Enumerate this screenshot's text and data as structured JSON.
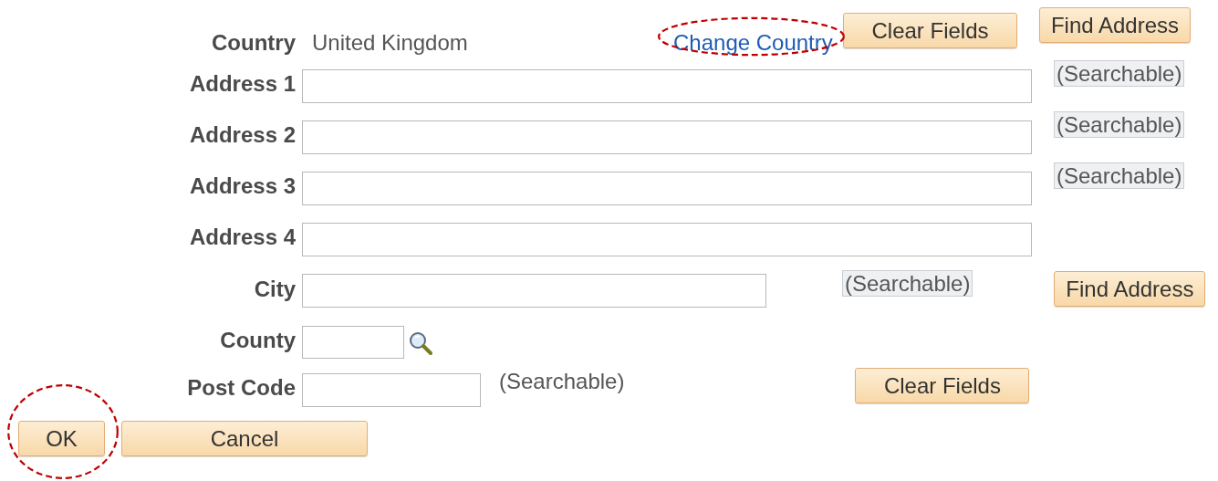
{
  "country": {
    "label": "Country",
    "value": "United Kingdom"
  },
  "change_country": {
    "label": "Change Country",
    "highlighted": true
  },
  "top_buttons": [
    {
      "label": "Clear Fields"
    },
    {
      "label": "Find Address"
    }
  ],
  "rows": [
    {
      "kind": "address",
      "label": "Address 1",
      "note": {
        "text": "(Searchable)",
        "boxed": true
      }
    },
    {
      "kind": "address",
      "label": "Address 2",
      "note": {
        "text": "(Searchable)",
        "boxed": true
      }
    },
    {
      "kind": "address",
      "label": "Address 3",
      "note": {
        "text": "(Searchable)",
        "boxed": true
      }
    },
    {
      "kind": "address",
      "label": "Address 4"
    },
    {
      "kind": "city",
      "label": "City",
      "note": {
        "text": "(Searchable)",
        "boxed": true
      },
      "button": {
        "label": "Find Address"
      }
    },
    {
      "kind": "county",
      "label": "County",
      "lookup": true
    },
    {
      "kind": "postcode",
      "label": "Post Code",
      "note": {
        "text": "(Searchable)",
        "boxed": false
      },
      "button": {
        "label": "Clear Fields"
      }
    }
  ],
  "actions": [
    {
      "label": "OK",
      "highlighted": true
    },
    {
      "label": "Cancel",
      "highlighted": false
    }
  ]
}
